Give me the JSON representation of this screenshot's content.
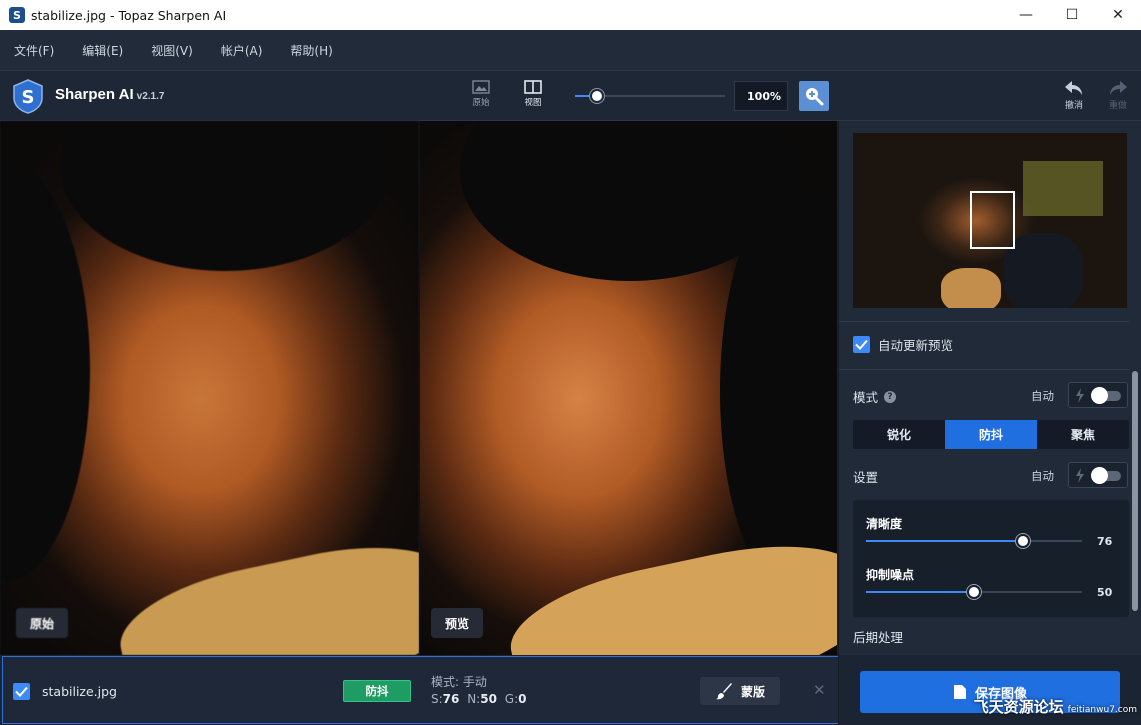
{
  "window": {
    "title": "stabilize.jpg - Topaz Sharpen AI",
    "app_icon_letter": "S",
    "minimize": "—",
    "maximize": "☐",
    "close": "✕"
  },
  "menu": [
    {
      "label": "文件(F)"
    },
    {
      "label": "编辑(E)"
    },
    {
      "label": "视图(V)"
    },
    {
      "label": "帐户(A)"
    },
    {
      "label": "帮助(H)"
    }
  ],
  "toolbar": {
    "brand": "Sharpen AI",
    "version": "v2.1.7",
    "original_btn": "原始",
    "view_btn": "视图",
    "zoom_value": "100%",
    "zoom_level_fraction": 0.15,
    "undo": "撤消",
    "redo": "重做"
  },
  "panes": {
    "left_label": "原始",
    "right_label": "预览"
  },
  "panel": {
    "auto_update_label": "自动更新预览",
    "auto_update_checked": true,
    "mode_title": "模式",
    "mode_help": "?",
    "mode_auto": "自动",
    "modes": [
      {
        "label": "锐化",
        "active": false
      },
      {
        "label": "防抖",
        "active": true
      },
      {
        "label": "聚焦",
        "active": false
      }
    ],
    "settings_title": "设置",
    "settings_auto": "自动",
    "sliders": [
      {
        "label": "清晰度",
        "value": "76",
        "level": 0.76
      },
      {
        "label": "抑制噪点",
        "value": "50",
        "level": 0.5
      }
    ],
    "post_title": "后期处理"
  },
  "file": {
    "name": "stabilize.jpg",
    "badge": "防抖",
    "mode_line": "模式: 手动",
    "s_label": "S:",
    "s_value": "76",
    "n_label": "N:",
    "n_value": "50",
    "g_label": "G:",
    "g_value": "0",
    "mask_btn": "蒙版",
    "remove": "✕"
  },
  "save": {
    "label": "保存图像"
  },
  "watermark": {
    "text": "飞天资源论坛",
    "domain": "feitianwu7.com"
  },
  "colors": {
    "accent": "#1f6fe0",
    "badge_green": "#1f9b64"
  }
}
